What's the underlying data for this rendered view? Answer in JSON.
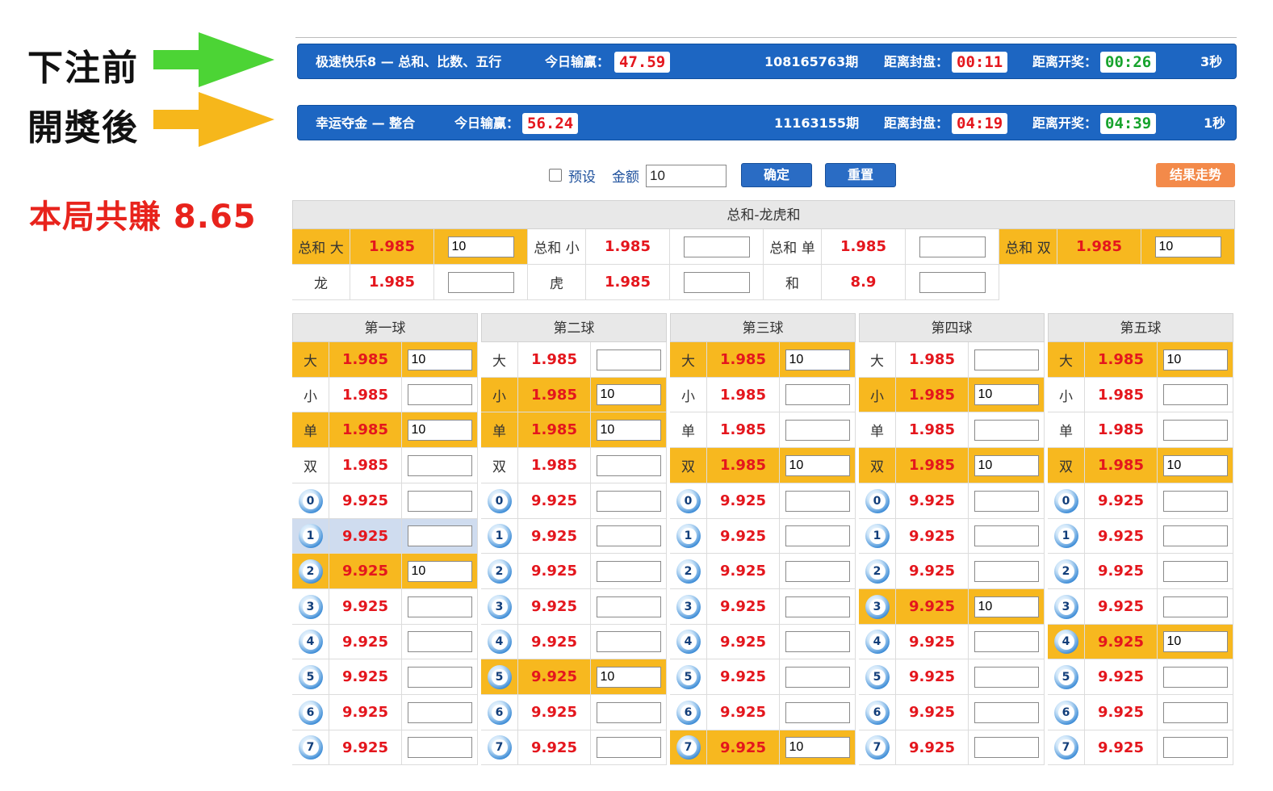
{
  "annotations": {
    "before_label": "下注前",
    "after_label": "開獎後",
    "profit_text": "本局共賺 8.65",
    "arrow_before_color": "#4cd435",
    "arrow_after_color": "#f6b71b"
  },
  "bars": [
    {
      "title": "极速快乐8 — 总和、比数、五行",
      "today_label": "今日输赢：",
      "today_value": "47.59",
      "period": "108165763期",
      "close_label": "距离封盘：",
      "close_time": "00:11",
      "draw_label": "距离开奖：",
      "draw_time": "00:26",
      "refresh": "3秒"
    },
    {
      "title": "幸运夺金 — 整合",
      "today_label": "今日输赢：",
      "today_value": "56.24",
      "period": "11163155期",
      "close_label": "距离封盘：",
      "close_time": "04:19",
      "draw_label": "距离开奖：",
      "draw_time": "04:39",
      "refresh": "1秒"
    }
  ],
  "controls": {
    "preset_label": "预设",
    "amount_label": "金额",
    "amount_value": "10",
    "confirm_label": "确定",
    "reset_label": "重置",
    "trend_label": "结果走势"
  },
  "sum_section": {
    "title": "总和-龙虎和",
    "row1": [
      {
        "label": "总和 大",
        "odds": "1.985",
        "value": "10",
        "hl": true
      },
      {
        "label": "总和 小",
        "odds": "1.985",
        "value": "",
        "hl": false
      },
      {
        "label": "总和 单",
        "odds": "1.985",
        "value": "",
        "hl": false
      },
      {
        "label": "总和 双",
        "odds": "1.985",
        "value": "10",
        "hl": true
      }
    ],
    "row2": [
      {
        "label": "龙",
        "odds": "1.985",
        "value": ""
      },
      {
        "label": "虎",
        "odds": "1.985",
        "value": ""
      },
      {
        "label": "和",
        "odds": "8.9",
        "value": ""
      }
    ]
  },
  "balls": [
    {
      "title": "第一球",
      "rows": [
        {
          "label": "大",
          "odds": "1.985",
          "value": "10",
          "state": "hl"
        },
        {
          "label": "小",
          "odds": "1.985",
          "value": "",
          "state": "norm"
        },
        {
          "label": "单",
          "odds": "1.985",
          "value": "10",
          "state": "hl"
        },
        {
          "label": "双",
          "odds": "1.985",
          "value": "",
          "state": "norm"
        },
        {
          "num": "0",
          "odds": "9.925",
          "value": "",
          "state": "norm"
        },
        {
          "num": "1",
          "odds": "9.925",
          "value": "",
          "state": "hl-blue"
        },
        {
          "num": "2",
          "odds": "9.925",
          "value": "10",
          "state": "hl"
        },
        {
          "num": "3",
          "odds": "9.925",
          "value": "",
          "state": "norm"
        },
        {
          "num": "4",
          "odds": "9.925",
          "value": "",
          "state": "norm"
        },
        {
          "num": "5",
          "odds": "9.925",
          "value": "",
          "state": "norm"
        },
        {
          "num": "6",
          "odds": "9.925",
          "value": "",
          "state": "norm"
        },
        {
          "num": "7",
          "odds": "9.925",
          "value": "",
          "state": "norm"
        }
      ]
    },
    {
      "title": "第二球",
      "rows": [
        {
          "label": "大",
          "odds": "1.985",
          "value": "",
          "state": "norm"
        },
        {
          "label": "小",
          "odds": "1.985",
          "value": "10",
          "state": "hl"
        },
        {
          "label": "单",
          "odds": "1.985",
          "value": "10",
          "state": "hl"
        },
        {
          "label": "双",
          "odds": "1.985",
          "value": "",
          "state": "norm"
        },
        {
          "num": "0",
          "odds": "9.925",
          "value": "",
          "state": "norm"
        },
        {
          "num": "1",
          "odds": "9.925",
          "value": "",
          "state": "norm"
        },
        {
          "num": "2",
          "odds": "9.925",
          "value": "",
          "state": "norm"
        },
        {
          "num": "3",
          "odds": "9.925",
          "value": "",
          "state": "norm"
        },
        {
          "num": "4",
          "odds": "9.925",
          "value": "",
          "state": "norm"
        },
        {
          "num": "5",
          "odds": "9.925",
          "value": "10",
          "state": "hl"
        },
        {
          "num": "6",
          "odds": "9.925",
          "value": "",
          "state": "norm"
        },
        {
          "num": "7",
          "odds": "9.925",
          "value": "",
          "state": "norm"
        }
      ]
    },
    {
      "title": "第三球",
      "rows": [
        {
          "label": "大",
          "odds": "1.985",
          "value": "10",
          "state": "hl"
        },
        {
          "label": "小",
          "odds": "1.985",
          "value": "",
          "state": "norm"
        },
        {
          "label": "单",
          "odds": "1.985",
          "value": "",
          "state": "norm"
        },
        {
          "label": "双",
          "odds": "1.985",
          "value": "10",
          "state": "hl"
        },
        {
          "num": "0",
          "odds": "9.925",
          "value": "",
          "state": "norm"
        },
        {
          "num": "1",
          "odds": "9.925",
          "value": "",
          "state": "norm"
        },
        {
          "num": "2",
          "odds": "9.925",
          "value": "",
          "state": "norm"
        },
        {
          "num": "3",
          "odds": "9.925",
          "value": "",
          "state": "norm"
        },
        {
          "num": "4",
          "odds": "9.925",
          "value": "",
          "state": "norm"
        },
        {
          "num": "5",
          "odds": "9.925",
          "value": "",
          "state": "norm"
        },
        {
          "num": "6",
          "odds": "9.925",
          "value": "",
          "state": "norm"
        },
        {
          "num": "7",
          "odds": "9.925",
          "value": "10",
          "state": "hl"
        }
      ]
    },
    {
      "title": "第四球",
      "rows": [
        {
          "label": "大",
          "odds": "1.985",
          "value": "",
          "state": "norm"
        },
        {
          "label": "小",
          "odds": "1.985",
          "value": "10",
          "state": "hl"
        },
        {
          "label": "单",
          "odds": "1.985",
          "value": "",
          "state": "norm"
        },
        {
          "label": "双",
          "odds": "1.985",
          "value": "10",
          "state": "hl"
        },
        {
          "num": "0",
          "odds": "9.925",
          "value": "",
          "state": "norm"
        },
        {
          "num": "1",
          "odds": "9.925",
          "value": "",
          "state": "norm"
        },
        {
          "num": "2",
          "odds": "9.925",
          "value": "",
          "state": "norm"
        },
        {
          "num": "3",
          "odds": "9.925",
          "value": "10",
          "state": "hl"
        },
        {
          "num": "4",
          "odds": "9.925",
          "value": "",
          "state": "norm"
        },
        {
          "num": "5",
          "odds": "9.925",
          "value": "",
          "state": "norm"
        },
        {
          "num": "6",
          "odds": "9.925",
          "value": "",
          "state": "norm"
        },
        {
          "num": "7",
          "odds": "9.925",
          "value": "",
          "state": "norm"
        }
      ]
    },
    {
      "title": "第五球",
      "rows": [
        {
          "label": "大",
          "odds": "1.985",
          "value": "10",
          "state": "hl"
        },
        {
          "label": "小",
          "odds": "1.985",
          "value": "",
          "state": "norm"
        },
        {
          "label": "单",
          "odds": "1.985",
          "value": "",
          "state": "norm"
        },
        {
          "label": "双",
          "odds": "1.985",
          "value": "10",
          "state": "hl"
        },
        {
          "num": "0",
          "odds": "9.925",
          "value": "",
          "state": "norm"
        },
        {
          "num": "1",
          "odds": "9.925",
          "value": "",
          "state": "norm"
        },
        {
          "num": "2",
          "odds": "9.925",
          "value": "",
          "state": "norm"
        },
        {
          "num": "3",
          "odds": "9.925",
          "value": "",
          "state": "norm"
        },
        {
          "num": "4",
          "odds": "9.925",
          "value": "10",
          "state": "hl"
        },
        {
          "num": "5",
          "odds": "9.925",
          "value": "",
          "state": "norm"
        },
        {
          "num": "6",
          "odds": "9.925",
          "value": "",
          "state": "norm"
        },
        {
          "num": "7",
          "odds": "9.925",
          "value": "",
          "state": "norm"
        }
      ]
    }
  ]
}
